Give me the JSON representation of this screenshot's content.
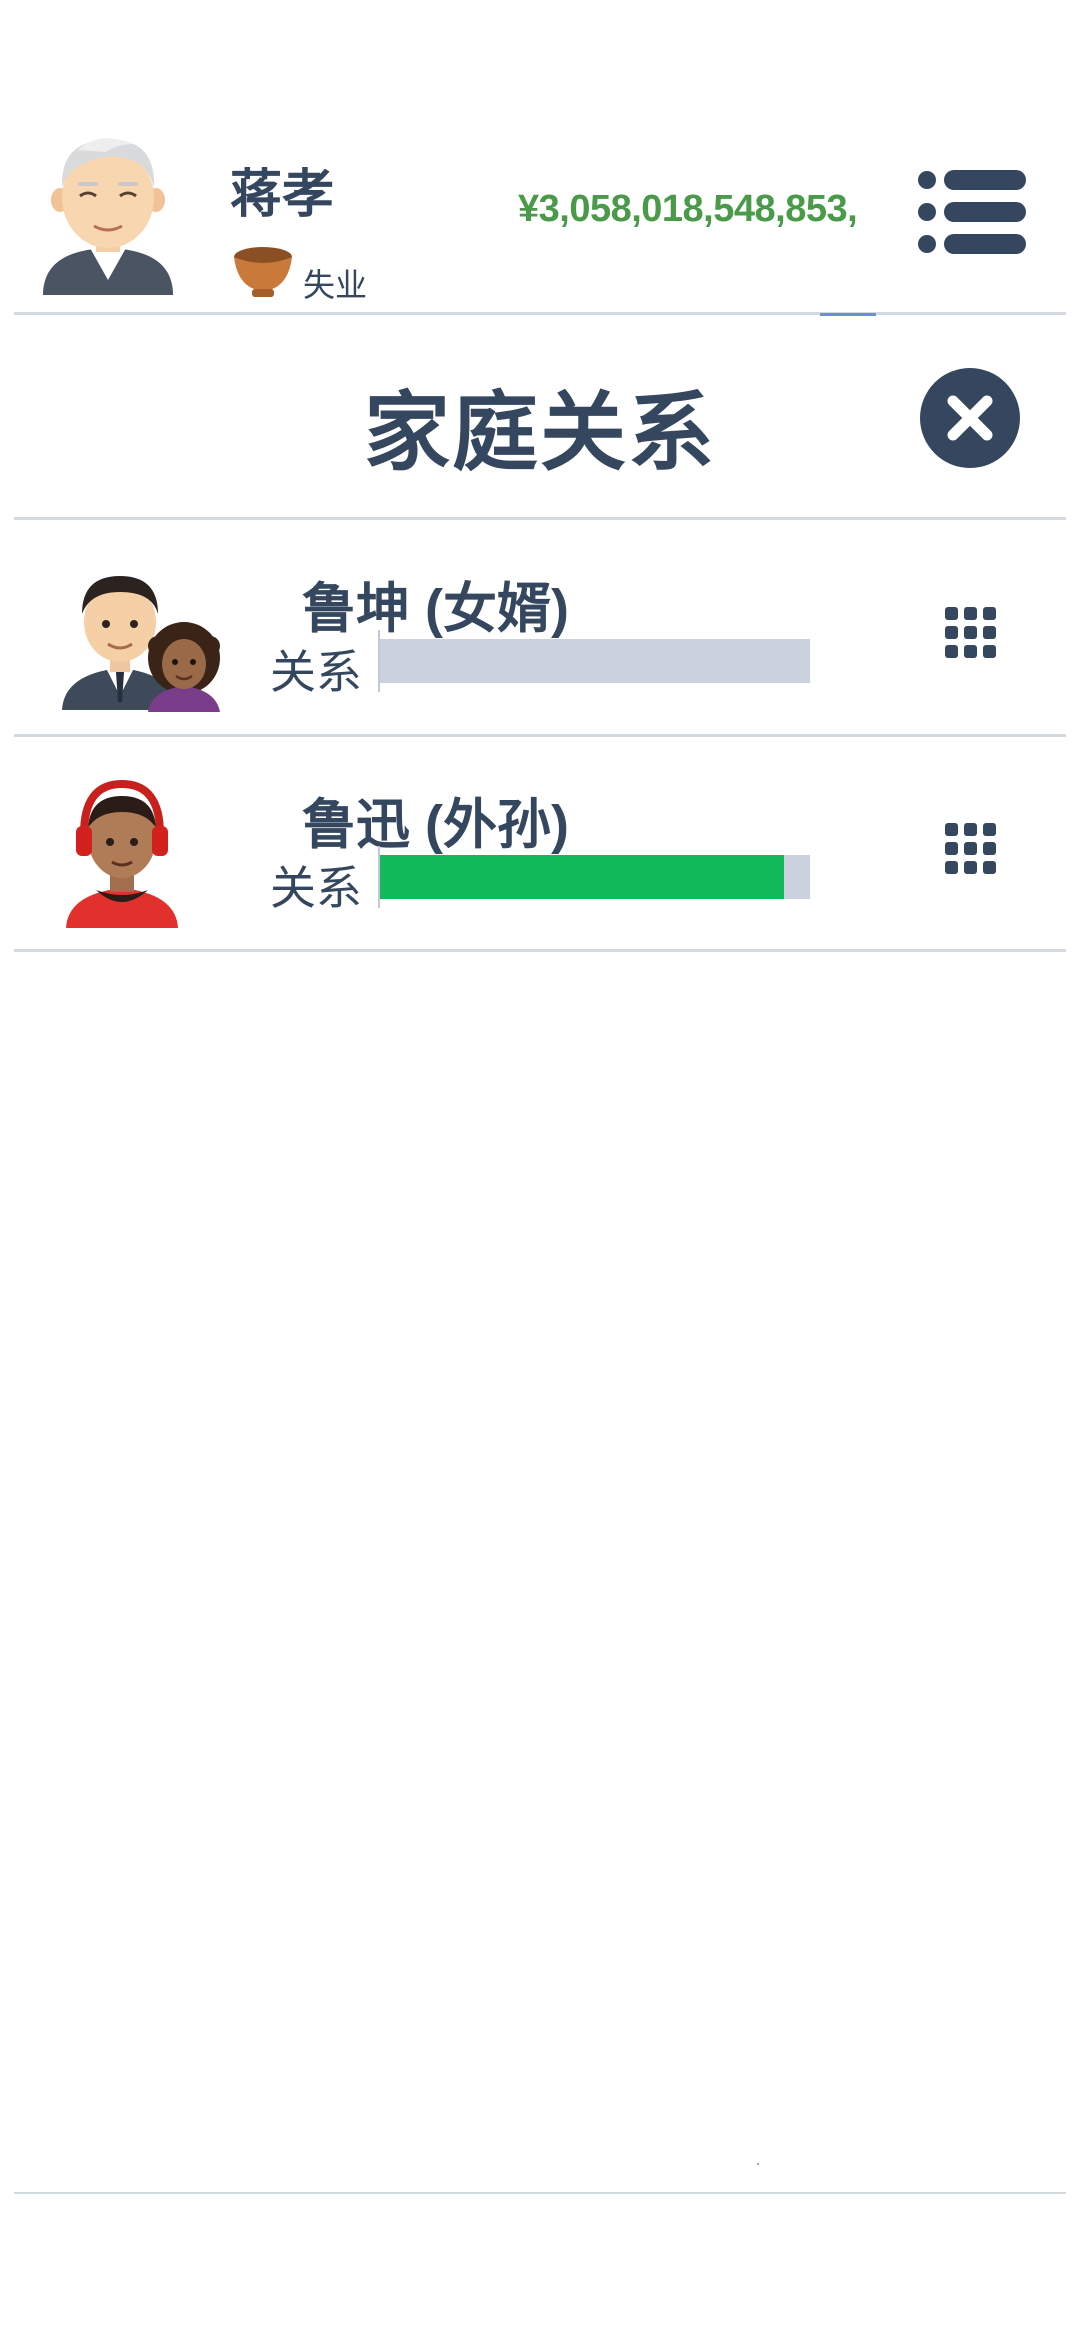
{
  "header": {
    "player_name": "蒋孝",
    "status": "失业",
    "status_icon": "bowl-icon",
    "money": "¥3,058,018,548,853,",
    "money_color": "#4a9a4a",
    "menu_icon": "list-menu-icon"
  },
  "modal": {
    "title": "家庭关系",
    "close_icon": "close-icon"
  },
  "relations": [
    {
      "name": "鲁坤 (女婿)",
      "label": "关系",
      "level": 0.0,
      "avatar": "couple-avatar-icon",
      "action_icon": "grid-icon"
    },
    {
      "name": "鲁迅 (外孙)",
      "label": "关系",
      "level": 0.94,
      "avatar": "boy-headphones-avatar-icon",
      "action_icon": "grid-icon"
    }
  ],
  "colors": {
    "text": "#34475e",
    "bar_track": "#cbd2dd",
    "bar_fill": "#12b95b"
  }
}
